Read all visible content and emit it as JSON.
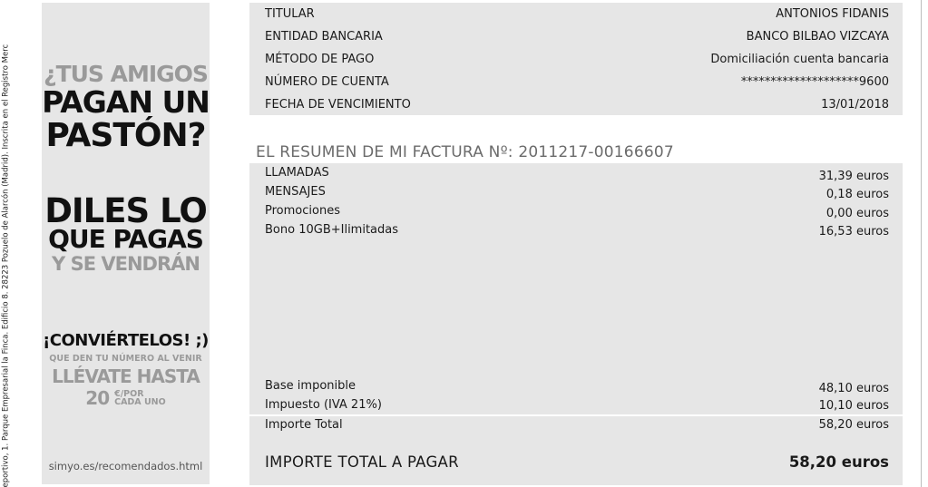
{
  "margin_text": "eportivo, 1. Parque Empresarial la Finca. Edificio 8. 28223 Pozuelo de Alarcón (Madrid). Inscrita en el Registro Merc",
  "promo": {
    "line1": "¿TUS AMIGOS",
    "line2": "PAGAN UN",
    "line3": "PASTÓN?",
    "line4": "DILES LO",
    "line5": "QUE PAGAS",
    "line6": "Y SE VENDRÁN",
    "line7": "¡CONVIÉRTELOS! ;)",
    "line8": "QUE DEN TU NÚMERO AL VENIR",
    "line9": "LLÉVATE HASTA",
    "amount": "20",
    "unit_top": "€/POR",
    "unit_bottom": "CADA UNO",
    "url": "simyo.es/recomendados.html"
  },
  "account": {
    "titular_label": "TITULAR",
    "titular_value": "ANTONIOS FIDANIS",
    "entidad_label": "ENTIDAD BANCARIA",
    "entidad_value": "BANCO BILBAO VIZCAYA",
    "metodo_label": "MÉTODO DE PAGO",
    "metodo_value": "Domiciliación cuenta bancaria",
    "cuenta_label": "NÚMERO DE CUENTA",
    "cuenta_value": "********************9600",
    "fecha_label": "FECHA DE VENCIMIENTO",
    "fecha_value": "13/01/2018"
  },
  "summary": {
    "title": "EL RESUMEN DE MI FACTURA Nº: 2011217-00166607",
    "items": [
      {
        "label": "LLAMADAS",
        "value": "31,39 euros"
      },
      {
        "label": "MENSAJES",
        "value": "0,18 euros"
      },
      {
        "label": "Promociones",
        "value": "0,00 euros"
      },
      {
        "label": "Bono 10GB+Ilimitadas",
        "value": "16,53 euros"
      }
    ],
    "base_label": "Base imponible",
    "base_value": "48,10 euros",
    "impuesto_label": "Impuesto (IVA 21%)",
    "impuesto_value": "10,10 euros",
    "importe_label": "Importe Total",
    "importe_value": "58,20 euros",
    "total_label": "IMPORTE TOTAL A PAGAR",
    "total_value": "58,20 euros"
  }
}
